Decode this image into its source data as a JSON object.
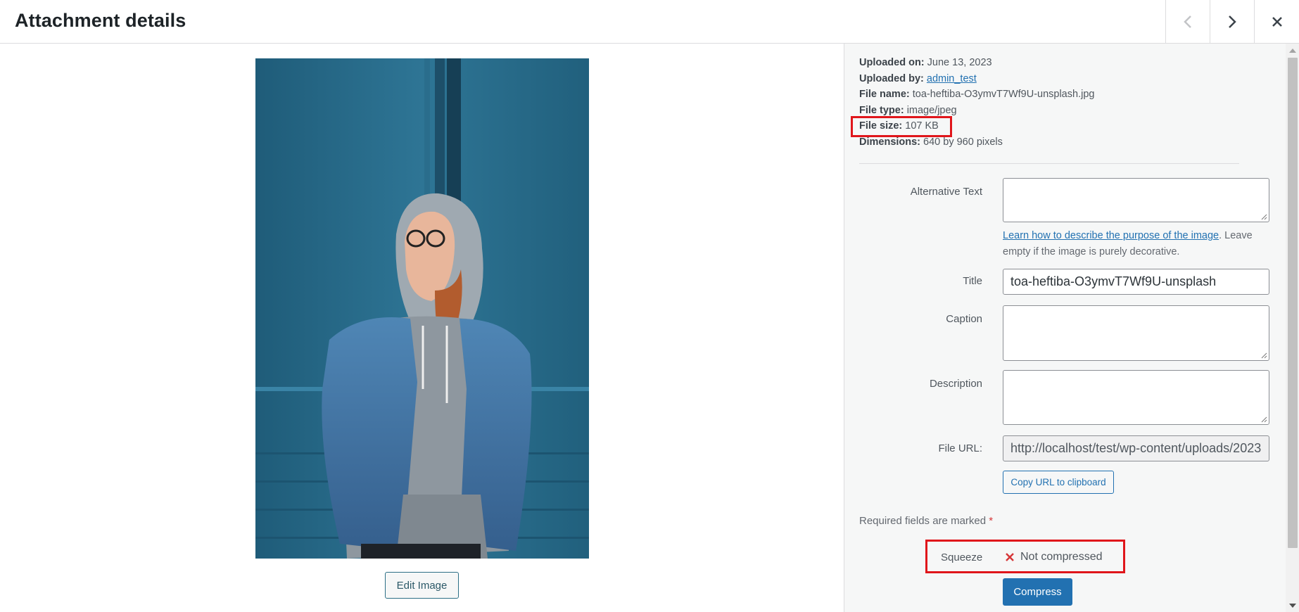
{
  "header": {
    "title": "Attachment details",
    "prev_icon": "chevron-left-icon",
    "next_icon": "chevron-right-icon",
    "close_icon": "close-icon"
  },
  "media": {
    "edit_button": "Edit Image"
  },
  "details": {
    "uploaded_on_label": "Uploaded on:",
    "uploaded_on": "June 13, 2023",
    "uploaded_by_label": "Uploaded by:",
    "uploaded_by": "admin_test",
    "file_name_label": "File name:",
    "file_name": "toa-heftiba-O3ymvT7Wf9U-unsplash.jpg",
    "file_type_label": "File type:",
    "file_type": "image/jpeg",
    "file_size_label": "File size:",
    "file_size": "107 KB",
    "dimensions_label": "Dimensions:",
    "dimensions": "640 by 960 pixels"
  },
  "form": {
    "alt_label": "Alternative Text",
    "alt_value": "",
    "alt_help_link": "Learn how to describe the purpose of the image",
    "alt_help_text": ". Leave empty if the image is purely decorative.",
    "title_label": "Title",
    "title_value": "toa-heftiba-O3ymvT7Wf9U-unsplash",
    "caption_label": "Caption",
    "caption_value": "",
    "description_label": "Description",
    "description_value": "",
    "file_url_label": "File URL:",
    "file_url_value": "http://localhost/test/wp-content/uploads/2023",
    "copy_button": "Copy URL to clipboard",
    "required_text": "Required fields are marked",
    "required_star": "*"
  },
  "squeeze": {
    "label": "Squeeze",
    "status_icon": "x-mark-icon",
    "status_text": "Not compressed",
    "compress_button": "Compress"
  },
  "colors": {
    "accent": "#2271b1",
    "highlight": "#e0161b",
    "status_error": "#d63638"
  }
}
